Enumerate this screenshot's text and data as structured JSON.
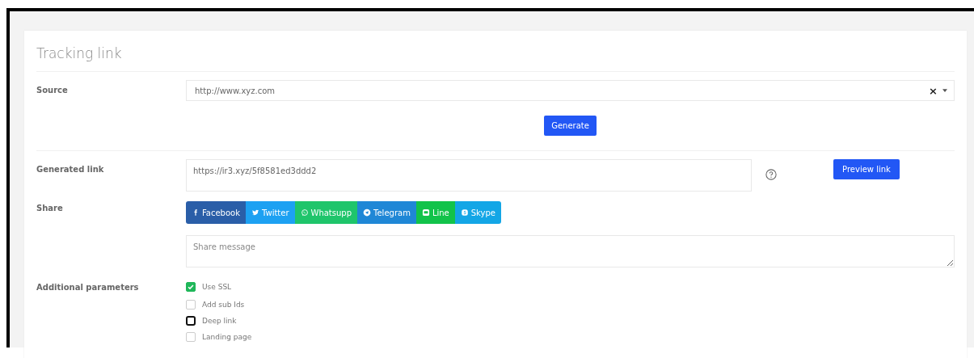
{
  "card": {
    "title": "Tracking link"
  },
  "source": {
    "label": "Source",
    "value": "http://www.xyz.com",
    "clear": "×",
    "button": "Generate"
  },
  "generated": {
    "label": "Generated link",
    "value": "https://ir3.xyz/5f8581ed3ddd2",
    "button": "Preview link"
  },
  "share": {
    "label": "Share",
    "buttons": [
      {
        "kind": "facebook",
        "label": "Facebook",
        "color": "#2a5ea8"
      },
      {
        "kind": "twitter",
        "label": "Twitter",
        "color": "#1da1f2"
      },
      {
        "kind": "whatsapp",
        "label": "Whatsupp",
        "color": "#1fc56b"
      },
      {
        "kind": "telegram",
        "label": "Telegram",
        "color": "#1f87d6"
      },
      {
        "kind": "line",
        "label": "Line",
        "color": "#12c34a"
      },
      {
        "kind": "skype",
        "label": "Skype",
        "color": "#13a6e6"
      }
    ],
    "message_placeholder": "Share message"
  },
  "parameters": {
    "label": "Additional parameters",
    "items": [
      {
        "label": "Use SSL",
        "checked": true,
        "focused": false
      },
      {
        "label": "Add sub Ids",
        "checked": false,
        "focused": false
      },
      {
        "label": "Deep link",
        "checked": false,
        "focused": true
      },
      {
        "label": "Landing page",
        "checked": false,
        "focused": false
      }
    ]
  }
}
